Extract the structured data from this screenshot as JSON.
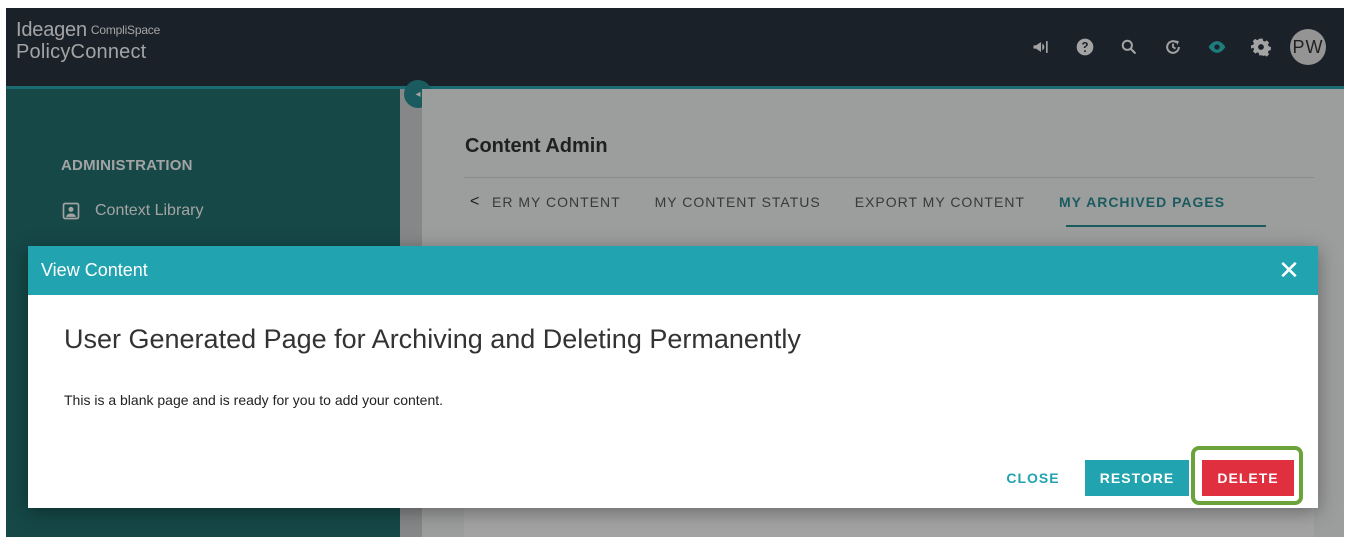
{
  "header": {
    "brand_line1": "Ideagen",
    "brand_line1_sub": "CompliSpace",
    "brand_line2": "PolicyConnect",
    "avatar_initials": "PW",
    "icons": [
      "megaphone-icon",
      "help-icon",
      "search-icon",
      "history-icon",
      "eye-icon",
      "gear-icon"
    ]
  },
  "sidebar": {
    "section_title": "ADMINISTRATION",
    "items": [
      {
        "label": "Context Library",
        "icon": "context-library-icon"
      }
    ]
  },
  "main": {
    "title": "Content Admin",
    "tabs": [
      {
        "label": "ER MY CONTENT",
        "active": false
      },
      {
        "label": "MY CONTENT STATUS",
        "active": false
      },
      {
        "label": "EXPORT MY CONTENT",
        "active": false
      },
      {
        "label": "MY ARCHIVED PAGES",
        "active": true
      }
    ]
  },
  "dialog": {
    "title": "View Content",
    "heading": "User Generated Page for Archiving and Deleting Permanently",
    "body": "This is a blank page and is ready for you to add your content.",
    "buttons": {
      "close": "CLOSE",
      "restore": "RESTORE",
      "delete": "DELETE"
    }
  },
  "colors": {
    "topbar": "#293540",
    "sidebar": "#22716f",
    "accent": "#22a3b0",
    "delete": "#e03040",
    "highlight": "#6aa339"
  }
}
